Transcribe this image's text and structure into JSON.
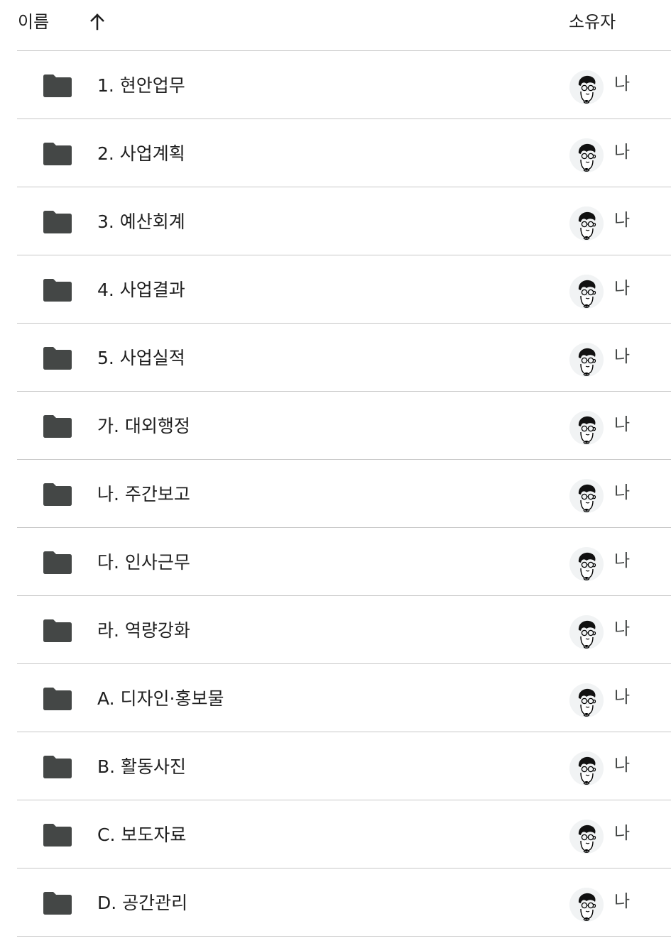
{
  "header": {
    "name_label": "이름",
    "owner_label": "소유자",
    "sort_icon": "arrow-up-icon"
  },
  "colors": {
    "folder": "#444746",
    "divider": "#c7c7c7",
    "text": "#1f1f1f",
    "avatar_bg": "#f1f3f4"
  },
  "rows": [
    {
      "name": "1. 현안업무",
      "owner": "나"
    },
    {
      "name": "2. 사업계획",
      "owner": "나"
    },
    {
      "name": "3. 예산회계",
      "owner": "나"
    },
    {
      "name": "4. 사업결과",
      "owner": "나"
    },
    {
      "name": "5. 사업실적",
      "owner": "나"
    },
    {
      "name": "가. 대외행정",
      "owner": "나"
    },
    {
      "name": "나. 주간보고",
      "owner": "나"
    },
    {
      "name": "다. 인사근무",
      "owner": "나"
    },
    {
      "name": "라. 역량강화",
      "owner": "나"
    },
    {
      "name": "A. 디자인·홍보물",
      "owner": "나"
    },
    {
      "name": "B. 활동사진",
      "owner": "나"
    },
    {
      "name": "C. 보도자료",
      "owner": "나"
    },
    {
      "name": "D. 공간관리",
      "owner": "나"
    }
  ]
}
